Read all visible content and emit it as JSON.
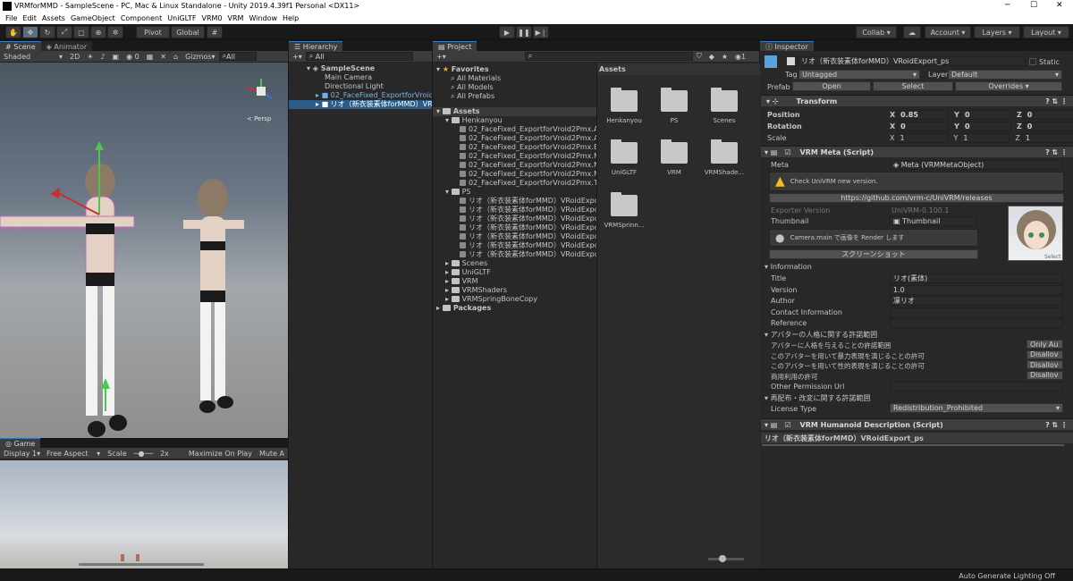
{
  "window": {
    "title": "VRMforMMD - SampleScene - PC, Mac & Linux Standalone - Unity 2019.4.39f1 Personal <DX11>",
    "minimize": "─",
    "maximize": "☐",
    "close": "✕"
  },
  "menu": [
    "File",
    "Edit",
    "Assets",
    "GameObject",
    "Component",
    "UniGLTF",
    "VRM0",
    "VRM",
    "Window",
    "Help"
  ],
  "toolbar": {
    "pivot": "Pivot",
    "global": "Global",
    "collab": "Collab ▾",
    "account": "Account",
    "layers": "Layers",
    "layout": "Layout"
  },
  "scene": {
    "tab": "Scene",
    "animator_tab": "Animator",
    "shading": "Shaded",
    "mode2d": "2D",
    "gizmos": "Gizmos",
    "search": "All",
    "persp": "< Persp",
    "counter": "0"
  },
  "game": {
    "tab": "Game",
    "display": "Display 1",
    "aspect": "Free Aspect",
    "scale_label": "Scale",
    "scale_value": "2x",
    "maximize": "Maximize On Play",
    "mute": "Mute A"
  },
  "hierarchy": {
    "tab": "Hierarchy",
    "search": "All",
    "scene": "SampleScene",
    "items": [
      "Main Camera",
      "Directional Light",
      "02_FaceFixed_ExportforVroid",
      "リオ（新衣装素体forMMD）VR"
    ]
  },
  "project": {
    "tab": "Project",
    "favorites": "Favorites",
    "fav_items": [
      "All Materials",
      "All Models",
      "All Prefabs"
    ],
    "assets": "Assets",
    "tree": [
      {
        "label": "Henkanyou",
        "level": 1,
        "folder": true,
        "open": true
      },
      {
        "label": "02_FaceFixed_ExportforVroid2Pmx.Avata",
        "level": 2
      },
      {
        "label": "02_FaceFixed_ExportforVroid2Pmx.Avata",
        "level": 2
      },
      {
        "label": "02_FaceFixed_ExportforVroid2Pmx.Blend",
        "level": 2
      },
      {
        "label": "02_FaceFixed_ExportforVroid2Pmx.Mater",
        "level": 2
      },
      {
        "label": "02_FaceFixed_ExportforVroid2Pmx.Mesh",
        "level": 2
      },
      {
        "label": "02_FaceFixed_ExportforVroid2Pmx.MetaO",
        "level": 2
      },
      {
        "label": "02_FaceFixed_ExportforVroid2Pmx.Textu",
        "level": 2
      },
      {
        "label": "PS",
        "level": 1,
        "folder": true,
        "open": true
      },
      {
        "label": "リオ（新衣装素体forMMD）VRoidExport_ps",
        "level": 2
      },
      {
        "label": "リオ（新衣装素体forMMD）VRoidExport_ps",
        "level": 2
      },
      {
        "label": "リオ（新衣装素体forMMD）VRoidExport_ps",
        "level": 2
      },
      {
        "label": "リオ（新衣装素体forMMD）VRoidExport_ps",
        "level": 2
      },
      {
        "label": "リオ（新衣装素体forMMD）VRoidExport_ps",
        "level": 2
      },
      {
        "label": "リオ（新衣装素体forMMD）VRoidExport_ps",
        "level": 2
      },
      {
        "label": "リオ（新衣装素体forMMD）VRoidExport_ps",
        "level": 2
      },
      {
        "label": "Scenes",
        "level": 1,
        "folder": true
      },
      {
        "label": "UniGLTF",
        "level": 1,
        "folder": true
      },
      {
        "label": "VRM",
        "level": 1,
        "folder": true
      },
      {
        "label": "VRMShaders",
        "level": 1,
        "folder": true
      },
      {
        "label": "VRMSpringBoneCopy",
        "level": 1,
        "folder": true
      }
    ],
    "packages": "Packages",
    "grid_title": "Assets",
    "grid": [
      "Henkanyou",
      "PS",
      "Scenes",
      "UniGLTF",
      "VRM",
      "VRMShade...",
      "VRMSprinn..."
    ],
    "count": "1"
  },
  "inspector": {
    "tab": "Inspector",
    "object": "リオ（新衣装素体forMMD）VRoidExport_ps",
    "static": "Static",
    "tag_label": "Tag",
    "tag": "Untagged",
    "layer_label": "Layer",
    "layer": "Default",
    "prefab": "Prefab",
    "open": "Open",
    "select": "Select",
    "overrides": "Overrides",
    "transform": {
      "title": "Transform",
      "rows": [
        {
          "label": "Position",
          "x": "0.85",
          "y": "0",
          "z": "0"
        },
        {
          "label": "Rotation",
          "x": "0",
          "y": "0",
          "z": "0"
        },
        {
          "label": "Scale",
          "x": "1",
          "y": "1",
          "z": "1"
        }
      ]
    },
    "meta": {
      "title": "VRM Meta (Script)",
      "meta_label": "Meta",
      "meta_value": "Meta (VRMMetaObject)",
      "warn": "Check UniVRM new version.",
      "url": "https://github.com/vrm-c/UniVRM/releases",
      "exporter_label": "Exporter Version",
      "exporter": "UniVRM-0.100.1",
      "thumb_label": "Thumbnail",
      "thumb": "Thumbnail",
      "cam_note": "Camera.main で画像を Render します",
      "shot_btn": "スクリーンショット",
      "thumb_select": "Select",
      "info": "Information",
      "fields": [
        {
          "label": "Title",
          "value": "リオ(素体)"
        },
        {
          "label": "Version",
          "value": "1.0"
        },
        {
          "label": "Author",
          "value": "凜リオ"
        },
        {
          "label": "Contact Information",
          "value": ""
        },
        {
          "label": "Reference",
          "value": ""
        }
      ],
      "avatar_section": "アバターの人格に関する許諾範囲",
      "perms": [
        {
          "label": "アバターに人格を与えることの許諾範囲",
          "value": "Only Au"
        },
        {
          "label": "このアバターを用いて暴力表現を演じることの許可",
          "value": "Disallov"
        },
        {
          "label": "このアバターを用いて性的表現を演じることの許可",
          "value": "Disallov"
        },
        {
          "label": "商用利用の許可",
          "value": "Disallov"
        }
      ],
      "other_perm": "Other Permission Url",
      "redist": "再配布・改変に関する許諾範囲",
      "license_label": "License Type",
      "license": "Redistribution_Prohibited"
    },
    "humanoid": {
      "title": "VRM Humanoid Description (Script)",
      "row": "リオ（新衣装素体forMMD）VRoidExport_ps"
    }
  },
  "status": "Auto Generate Lighting Off"
}
